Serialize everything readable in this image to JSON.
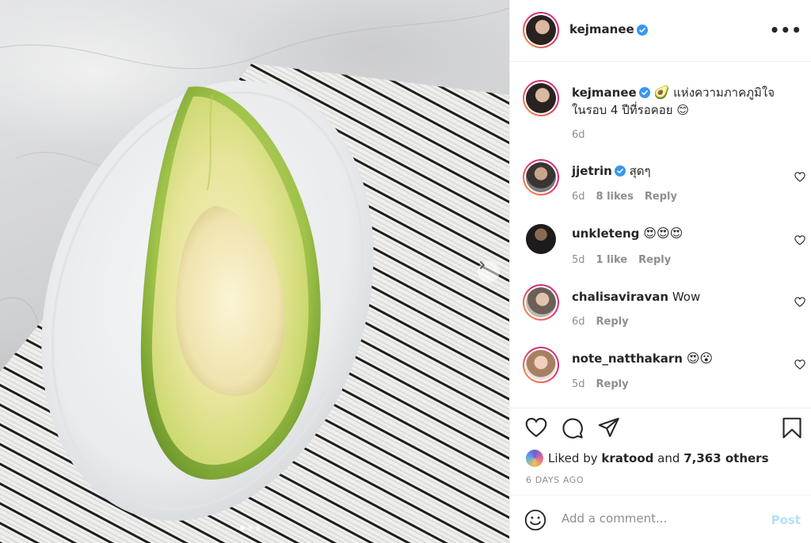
{
  "post": {
    "author": "kejmanee",
    "verified": true,
    "more_label": "•••",
    "image_description_icon": "avocado-photo",
    "carousel": {
      "slide_count": 3,
      "active_index": 0
    }
  },
  "caption": {
    "username": "kejmanee",
    "emoji": "🥑",
    "text": " แห่งความภาคภูมิใจ ในรอบ 4 ปีที่รอคอย 😊",
    "time": "6d"
  },
  "comments": [
    {
      "username": "jjetrin",
      "verified": true,
      "text": "สุดๆ",
      "time": "6d",
      "likes": "8 likes",
      "reply": "Reply"
    },
    {
      "username": "unkleteng",
      "verified": false,
      "text": "😍😍😍",
      "time": "5d",
      "likes": "1 like",
      "reply": "Reply"
    },
    {
      "username": "chalisaviravan",
      "verified": false,
      "text": "Wow",
      "time": "6d",
      "likes": "",
      "reply": "Reply"
    },
    {
      "username": "note_natthakarn",
      "verified": false,
      "text": "😍😮",
      "time": "5d",
      "likes": "",
      "reply": "Reply"
    }
  ],
  "likes": {
    "prefix": "Liked by",
    "user": "kratood",
    "and": "and",
    "others": "7,363 others"
  },
  "timestamp": "6 DAYS AGO",
  "add_comment": {
    "placeholder": "Add a comment...",
    "post_label": "Post"
  },
  "colors": {
    "verified": "#3897f0",
    "post_disabled": "#b2dffc",
    "muted": "#8e8e8e",
    "text": "#262626"
  }
}
